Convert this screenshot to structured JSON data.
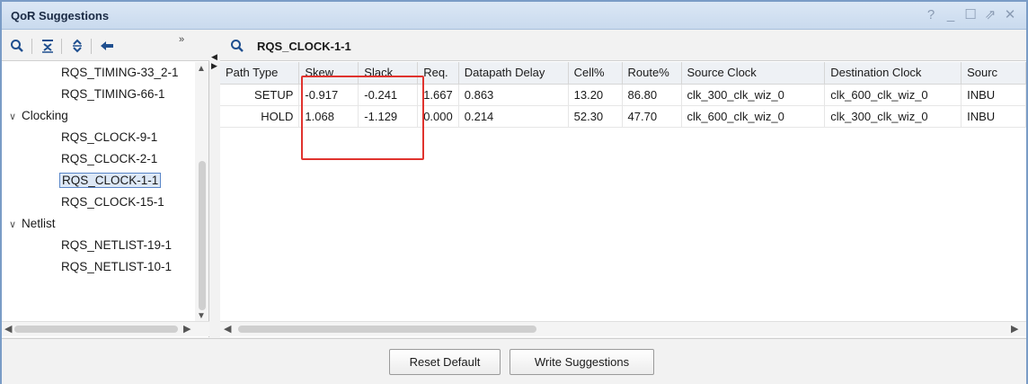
{
  "window": {
    "title": "QoR Suggestions",
    "controls": [
      "?",
      "_",
      "☐",
      "⇗",
      "✕"
    ]
  },
  "left_toolbar": {
    "icons": [
      "search-icon",
      "collapse-all-icon",
      "expand-all-icon",
      "back-arrow-icon"
    ],
    "more": "»"
  },
  "tree": [
    {
      "label": "RQS_TIMING-33_2-1",
      "level": 1,
      "selected": false
    },
    {
      "label": "RQS_TIMING-66-1",
      "level": 1,
      "selected": false
    },
    {
      "label": "Clocking",
      "level": 0,
      "selected": false
    },
    {
      "label": "RQS_CLOCK-9-1",
      "level": 1,
      "selected": false
    },
    {
      "label": "RQS_CLOCK-2-1",
      "level": 1,
      "selected": false
    },
    {
      "label": "RQS_CLOCK-1-1",
      "level": 1,
      "selected": true
    },
    {
      "label": "RQS_CLOCK-15-1",
      "level": 1,
      "selected": false
    },
    {
      "label": "Netlist",
      "level": 0,
      "selected": false
    },
    {
      "label": "RQS_NETLIST-19-1",
      "level": 1,
      "selected": false
    },
    {
      "label": "RQS_NETLIST-10-1",
      "level": 1,
      "selected": false
    }
  ],
  "detail": {
    "title": "RQS_CLOCK-1-1",
    "columns": [
      "Path Type",
      "Skew",
      "Slack",
      "Req.",
      "Datapath Delay",
      "Cell%",
      "Route%",
      "Source Clock",
      "Destination Clock",
      "Sourc"
    ],
    "rows": [
      [
        "SETUP",
        "-0.917",
        "-0.241",
        "1.667",
        "0.863",
        "13.20",
        "86.80",
        "clk_300_clk_wiz_0",
        "clk_600_clk_wiz_0",
        "INBU"
      ],
      [
        "HOLD",
        "1.068",
        "-1.129",
        "0.000",
        "0.214",
        "52.30",
        "47.70",
        "clk_600_clk_wiz_0",
        "clk_300_clk_wiz_0",
        "INBU"
      ]
    ],
    "highlighted_columns": [
      "Skew",
      "Slack"
    ],
    "highlight_color": "#e0332e"
  },
  "buttons": {
    "reset": "Reset Default",
    "write": "Write Suggestions"
  }
}
